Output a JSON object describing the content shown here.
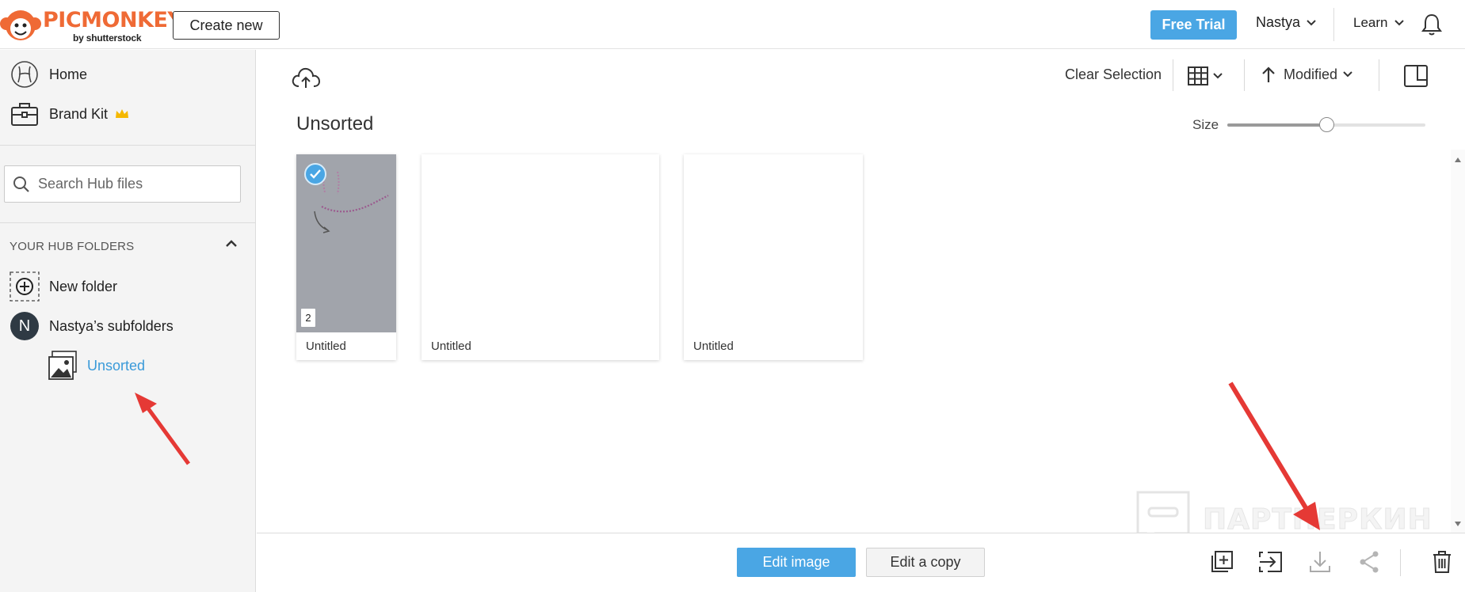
{
  "header": {
    "logo_text": "PICMONKEY",
    "logo_byline": "by shutterstock",
    "create_new_label": "Create new",
    "free_trial_label": "Free Trial",
    "user_name": "Nastya",
    "learn_label": "Learn"
  },
  "sidebar": {
    "nav": [
      {
        "label": "Home",
        "icon": "home-icon"
      },
      {
        "label": "Brand Kit",
        "icon": "briefcase-icon",
        "badge_icon": "crown-icon"
      }
    ],
    "search_placeholder": "Search Hub files",
    "folders_title": "YOUR HUB FOLDERS",
    "new_folder_label": "New folder",
    "subfolders_label": "Nastya’s subfolders",
    "avatar_letter": "N",
    "active_folder_label": "Unsorted"
  },
  "toolbar": {
    "clear_selection_label": "Clear Selection",
    "sort_label": "Modified",
    "size_label": "Size",
    "size_value": 0.5
  },
  "main": {
    "title": "Unsorted",
    "files": [
      {
        "name": "Untitled",
        "selected": true,
        "page_count": "2"
      },
      {
        "name": "Untitled",
        "selected": false
      },
      {
        "name": "Untitled",
        "selected": false
      }
    ]
  },
  "bottom": {
    "edit_image_label": "Edit image",
    "edit_copy_label": "Edit a copy"
  },
  "watermark_text": "ПАРТНЕРКИН",
  "colors": {
    "accent": "#4aa6e4",
    "brand": "#ef6a35",
    "annotation": "#e53935"
  }
}
